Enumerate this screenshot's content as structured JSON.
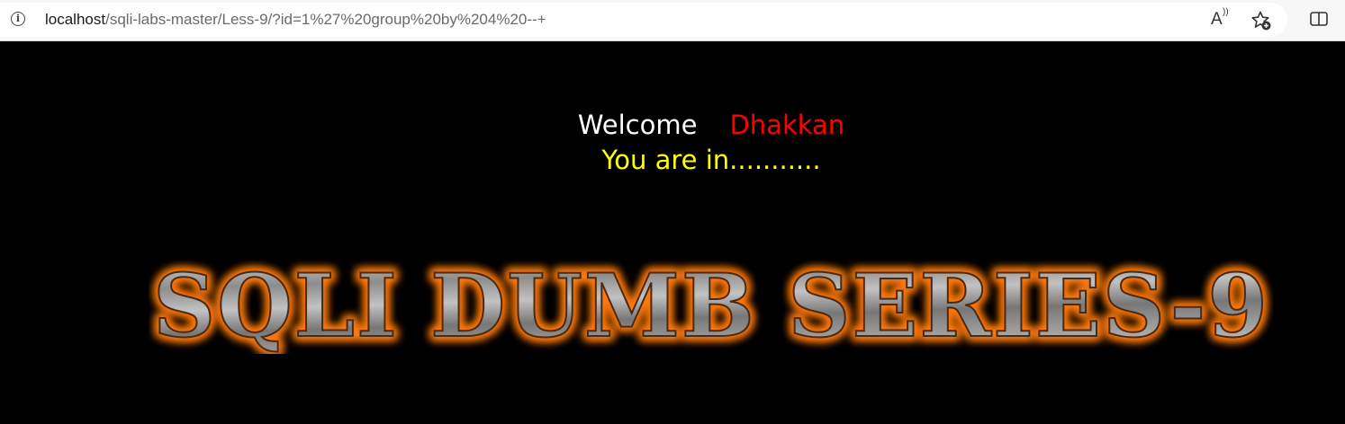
{
  "browser": {
    "url_host": "localhost",
    "url_path": "/sqli-labs-master/Less-9/?id=1%27%20group%20by%204%20--+",
    "read_aloud_icon": "read-aloud-icon",
    "favorites_icon": "add-favorite-icon",
    "split_icon": "split-screen-icon"
  },
  "page": {
    "welcome": "Welcome",
    "username": "Dhakkan",
    "status": "You are in...........",
    "banner": "SQLI DUMB SERIES-9"
  },
  "colors": {
    "background": "#000000",
    "welcome": "#ffffff",
    "username": "#ff0000",
    "status": "#ffff00",
    "banner_glow": "#ff6a00"
  }
}
